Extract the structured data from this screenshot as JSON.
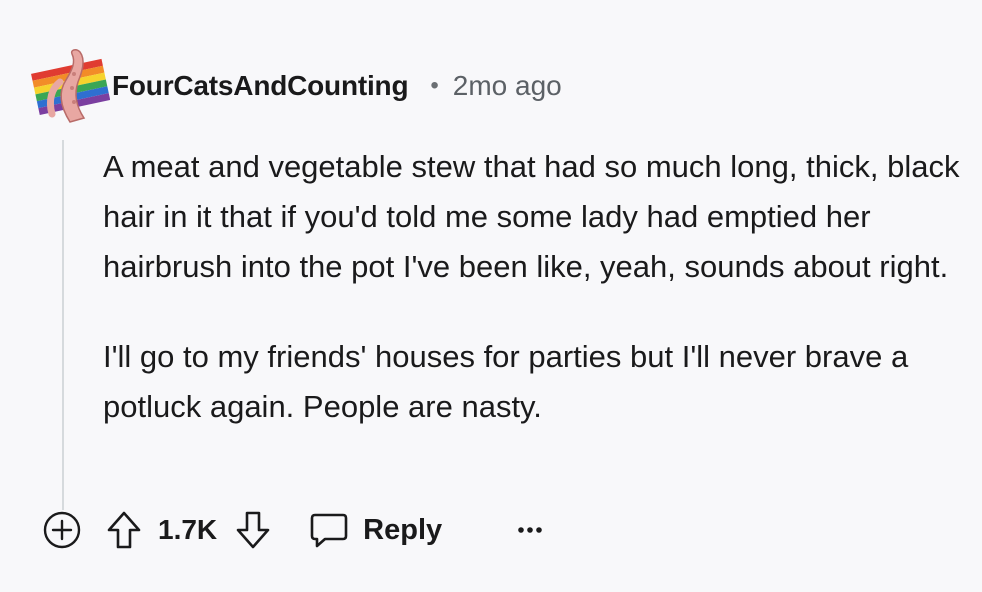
{
  "comment": {
    "author": "FourCatsAndCounting",
    "separator": "•",
    "timestamp": "2mo ago",
    "paragraphs": [
      "A meat and vegetable stew that had so much long, thick, black hair in it that if you'd told me some lady had emptied her hairbrush into the pot I've been like, yeah, sounds about right.",
      "I'll go to my friends' houses for parties but I'll never brave a potluck again. People are nasty."
    ]
  },
  "actions": {
    "score": "1.7K",
    "reply_label": "Reply"
  },
  "icons": {
    "expand": "plus-circle-icon",
    "upvote": "arrow-up-icon",
    "downvote": "arrow-down-icon",
    "reply": "speech-bubble-icon",
    "more": "ellipsis-icon"
  },
  "colors": {
    "background": "#f8f8fa",
    "text": "#1a1a1b",
    "meta": "#5c6166",
    "thread_line": "#d6dadd"
  }
}
